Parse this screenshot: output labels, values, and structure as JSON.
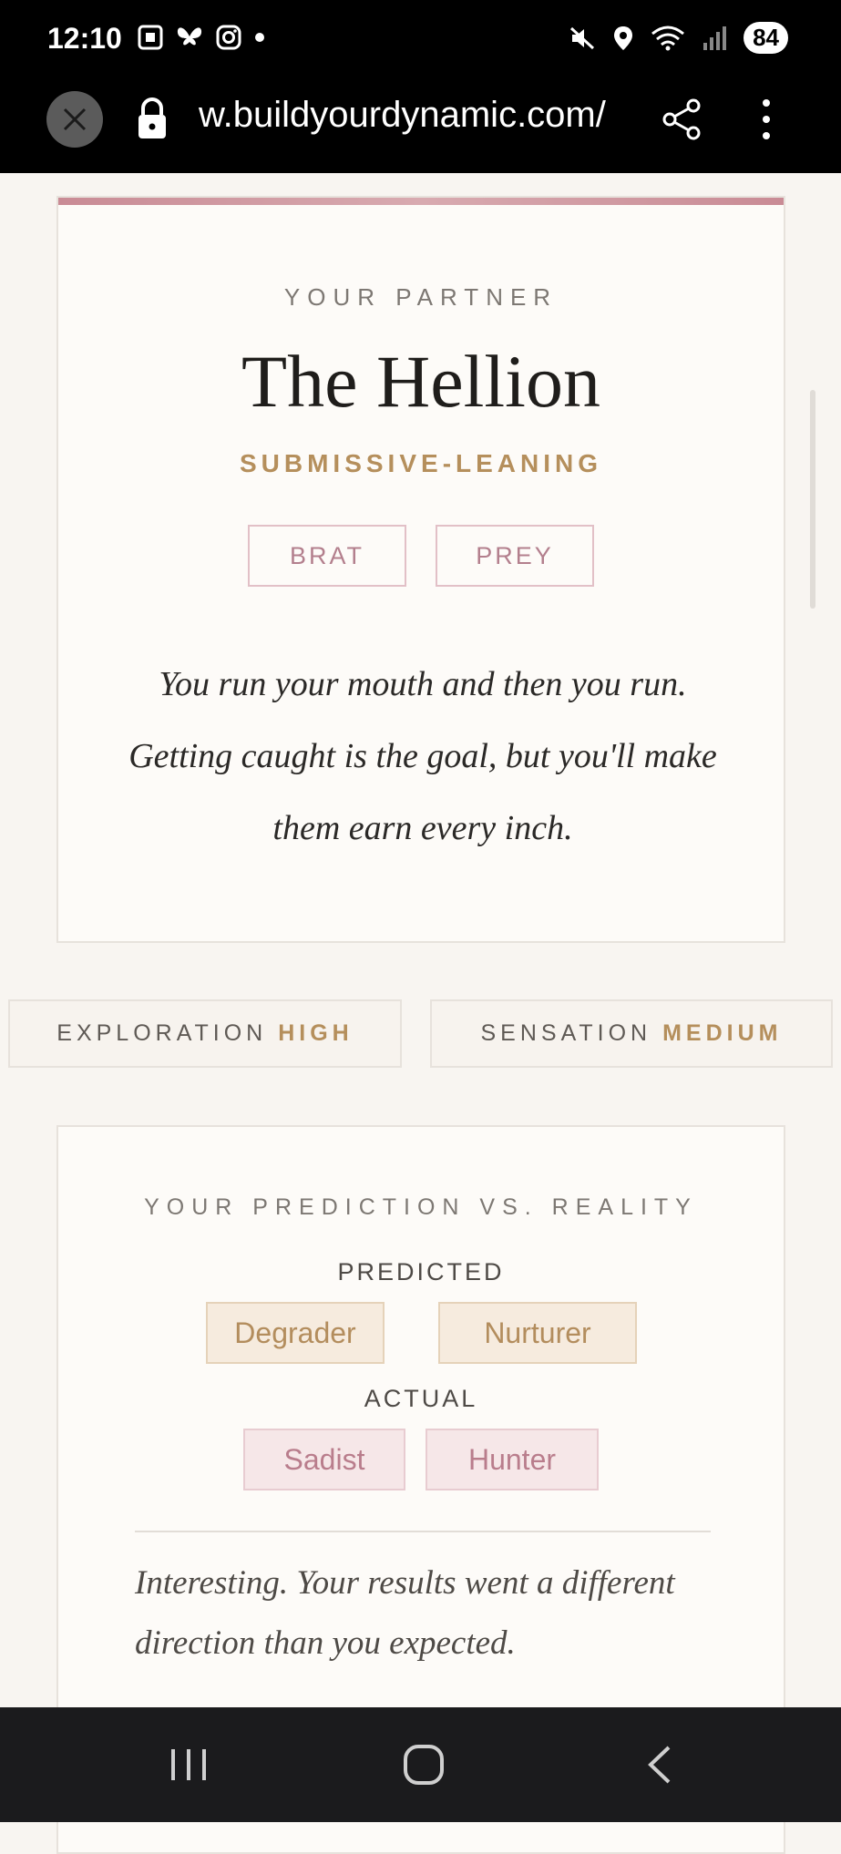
{
  "status_bar": {
    "time": "12:10",
    "battery": "84"
  },
  "browser": {
    "url": "w.buildyourdynamic.com/"
  },
  "result_card": {
    "eyebrow": "YOUR PARTNER",
    "title": "The Hellion",
    "subtitle": "SUBMISSIVE-LEANING",
    "tags": [
      "BRAT",
      "PREY"
    ],
    "description": "You run your mouth and then you run. Getting caught is the goal, but you'll make them earn every inch."
  },
  "stats": [
    {
      "label": "EXPLORATION",
      "value": "HIGH"
    },
    {
      "label": "SENSATION",
      "value": "MEDIUM"
    }
  ],
  "prediction_card": {
    "heading": "YOUR PREDICTION VS. REALITY",
    "predicted_label": "PREDICTED",
    "predicted": [
      "Degrader",
      "Nurturer"
    ],
    "actual_label": "ACTUAL",
    "actual": [
      "Sadist",
      "Hunter"
    ],
    "note": "Interesting. Your results went a different direction than you expected."
  },
  "colors": {
    "accent_gold": "#b58f5c",
    "accent_rose": "#b37f8d",
    "background": "#f8f5f1"
  }
}
